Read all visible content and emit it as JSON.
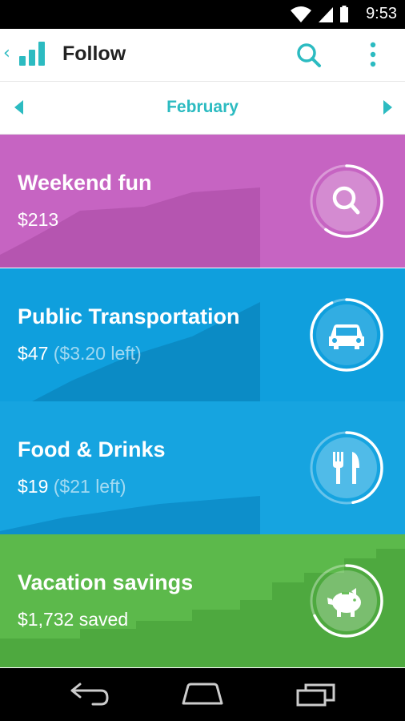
{
  "status": {
    "time": "9:53"
  },
  "app_bar": {
    "title": "Follow",
    "back_glyph": "‹"
  },
  "month": {
    "label": "February"
  },
  "categories": [
    {
      "name": "Weekend fun",
      "amount": "$213",
      "note": "",
      "color": "#c664c2",
      "shade": "#b555b0",
      "icon": "search-icon",
      "progress": 0.6
    },
    {
      "name": "Public Transportation",
      "amount": "$47",
      "note": "($3.20 left)",
      "color": "#0f9fdd",
      "shade": "#0b8bc5",
      "icon": "car-icon",
      "progress": 0.93
    },
    {
      "name": "Food & Drinks",
      "amount": "$19",
      "note": "($21 left)",
      "color": "#16a4e0",
      "shade": "#0d8fcb",
      "icon": "fork-knife-icon",
      "progress": 0.47
    },
    {
      "name": "Vacation savings",
      "amount": "$1,732 saved",
      "note": "",
      "color": "#5cb94b",
      "shade": "#4ea93f",
      "icon": "piggy-bank-icon",
      "progress": 0.68
    }
  ]
}
